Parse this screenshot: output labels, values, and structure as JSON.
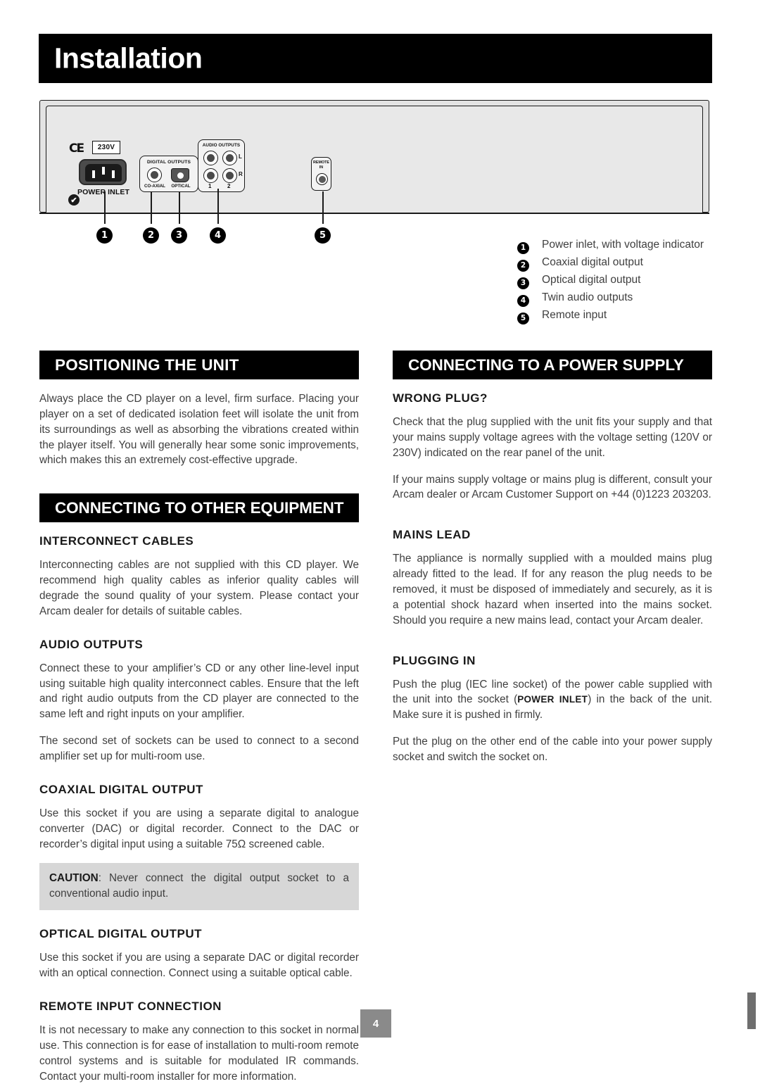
{
  "page": {
    "title": "Installation",
    "number": "4"
  },
  "diagram": {
    "name": "rear-panel-illustration",
    "ce_mark": "CE",
    "voltage_label": "230V",
    "power_inlet_label": "POWER INLET",
    "tick_mark": "✔",
    "digital_outputs": {
      "caption": "DIGITAL OUTPUTS",
      "coaxial_label": "CO-AXIAL",
      "optical_label": "OPTICAL"
    },
    "audio_outputs": {
      "caption": "AUDIO OUTPUTS",
      "row_left": "L",
      "row_right": "R",
      "col_one": "1",
      "col_two": "2"
    },
    "remote_input": {
      "caption_line1": "REMOTE",
      "caption_line2": "IN"
    },
    "callouts": [
      "1",
      "2",
      "3",
      "4",
      "5"
    ]
  },
  "legend": {
    "items": [
      {
        "num": "❶",
        "text": "Power inlet, with voltage indicator"
      },
      {
        "num": "❷",
        "text": "Coaxial digital output"
      },
      {
        "num": "❸",
        "text": "Optical digital output"
      },
      {
        "num": "❹",
        "text": "Twin audio outputs"
      },
      {
        "num": "❺",
        "text": "Remote input"
      }
    ],
    "nums": [
      "1",
      "2",
      "3",
      "4",
      "5"
    ]
  },
  "left_column": {
    "positioning": {
      "bar": "POSITIONING THE UNIT",
      "body": "Always place the CD player on a level, firm surface. Placing your player on a set of dedicated isolation feet will isolate the unit from its surroundings as well as absorbing the vibrations created within the player itself. You will generally hear some sonic improvements, which makes this an extremely cost-effective upgrade."
    },
    "connecting_other": {
      "bar": "CONNECTING TO OTHER EQUIPMENT",
      "interconnect_heading": "INTERCONNECT CABLES",
      "interconnect_body": "Interconnecting cables are not supplied with this CD player. We recommend high quality cables as inferior quality cables will degrade the sound quality of your system. Please contact your Arcam dealer for details of suitable cables.",
      "audio_heading": "AUDIO OUTPUTS",
      "audio_body1": "Connect these to your amplifier’s CD or any other line-level input using suitable high quality interconnect cables. Ensure that the left and right audio outputs from the CD player are connected to the same left and right inputs on your amplifier.",
      "audio_body2": "The second set of sockets can be used to connect to a second amplifier set up for multi-room use.",
      "coaxial_heading": "COAXIAL DIGITAL OUTPUT",
      "coaxial_body": "Use this socket if you are using a separate digital to analogue converter (DAC) or digital recorder. Connect to the DAC or recorder’s digital input using a suitable 75Ω screened cable.",
      "caution_label": "CAUTION",
      "caution_body": ": Never connect the digital output socket to a conventional audio input.",
      "optical_heading": "OPTICAL DIGITAL OUTPUT",
      "optical_body": "Use this socket if you are using a separate DAC or digital recorder with an optical connection. Connect using a suitable optical cable.",
      "remote_heading": "REMOTE INPUT CONNECTION",
      "remote_body": "It is not necessary to make any connection to this socket in normal use. This connection is for ease of installation to multi-room remote control systems and is suitable for modulated IR commands. Contact your multi-room installer for more information."
    }
  },
  "right_column": {
    "power_supply": {
      "bar": "CONNECTING TO A POWER SUPPLY",
      "wrong_plug_heading": "WRONG PLUG?",
      "wrong_plug_body1": "Check that the plug supplied with the unit fits your supply and that your mains supply voltage agrees with the voltage setting (120V or 230V) indicated on the rear panel of the unit.",
      "wrong_plug_body2": "If your mains supply voltage or mains plug is different, consult your Arcam dealer or Arcam Customer Support on +44 (0)1223 203203.",
      "mains_lead_heading": "MAINS LEAD",
      "mains_lead_body": "The appliance is normally supplied with a moulded mains plug already fitted to the lead. If for any reason the plug needs to be removed, it must be disposed of immediately and securely, as it is a potential shock hazard when inserted into the mains socket. Should you require a new mains lead, contact your Arcam dealer.",
      "plugging_heading": "PLUGGING IN",
      "plugging_body1_pre": "Push the plug (IEC line socket) of the power cable supplied with the unit into the socket (",
      "plugging_body1_bold": "POWER INLET",
      "plugging_body1_post": ") in the back of the unit. Make sure it is pushed in firmly.",
      "plugging_body2": "Put the plug on the other end of the cable into your power supply socket and switch the socket on."
    }
  },
  "colors": {
    "bar_background": "#000000",
    "caution_background": "#d7d7d7",
    "panel_fill": "#e3e3e3",
    "body_text": "#3f3f3f",
    "page_number_background": "#8a8a8a"
  }
}
